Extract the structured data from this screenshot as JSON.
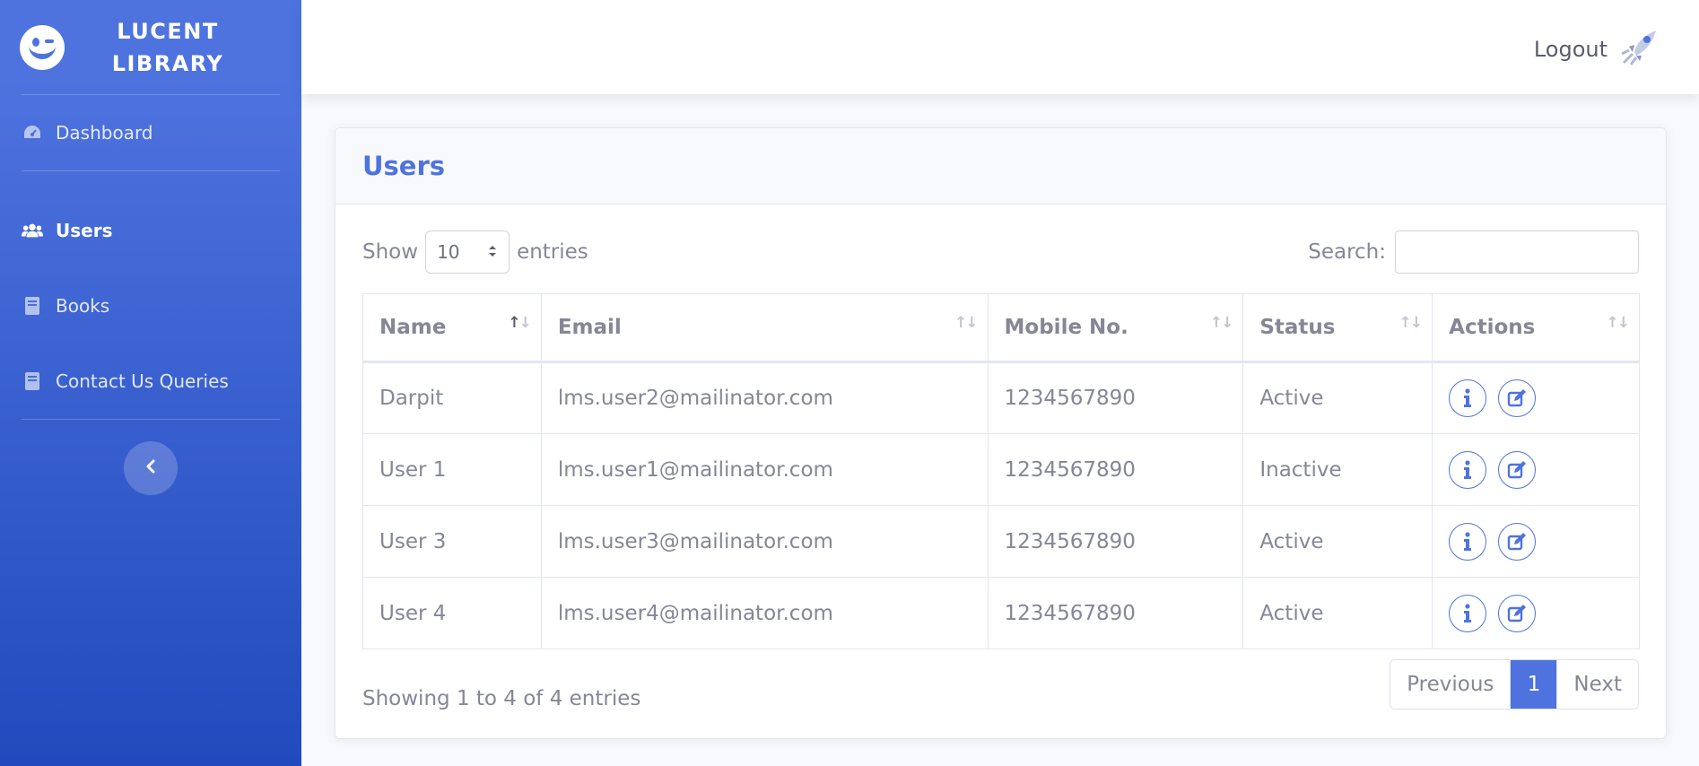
{
  "sidebar": {
    "brand": "LUCENT LIBRARY",
    "items": [
      {
        "label": "Dashboard",
        "icon": "tachometer-icon",
        "active": false
      },
      {
        "label": "Users",
        "icon": "users-icon",
        "active": true
      },
      {
        "label": "Books",
        "icon": "book-icon",
        "active": false
      },
      {
        "label": "Contact Us Queries",
        "icon": "book-icon",
        "active": false
      }
    ],
    "toggle_icon": "chevron-left-icon"
  },
  "topbar": {
    "logout_label": "Logout",
    "logout_icon": "rocket-icon"
  },
  "card": {
    "title": "Users",
    "show_label": "Show",
    "entries_label": "entries",
    "page_size": "10",
    "search_label": "Search:",
    "search_value": ""
  },
  "table": {
    "columns": [
      "Name",
      "Email",
      "Mobile No.",
      "Status",
      "Actions"
    ],
    "rows": [
      {
        "name": "Darpit",
        "email": "lms.user2@mailinator.com",
        "mobile": "1234567890",
        "status": "Active"
      },
      {
        "name": "User 1",
        "email": "lms.user1@mailinator.com",
        "mobile": "1234567890",
        "status": "Inactive"
      },
      {
        "name": "User 3",
        "email": "lms.user3@mailinator.com",
        "mobile": "1234567890",
        "status": "Active"
      },
      {
        "name": "User 4",
        "email": "lms.user4@mailinator.com",
        "mobile": "1234567890",
        "status": "Active"
      }
    ]
  },
  "footer": {
    "info": "Showing 1 to 4 of 4 entries",
    "previous": "Previous",
    "current_page": "1",
    "next": "Next"
  },
  "colors": {
    "primary": "#4e73df",
    "sidebar_gradient_end": "#224abe",
    "text": "#858796"
  }
}
